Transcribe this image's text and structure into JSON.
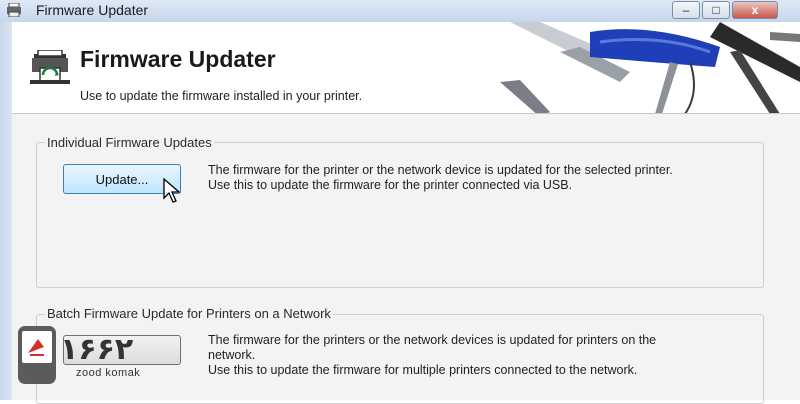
{
  "window": {
    "title": "Firmware Updater",
    "controls": {
      "minimize": "–",
      "maximize": "□",
      "close": "x"
    }
  },
  "header": {
    "title": "Firmware Updater",
    "subtitle": "Use to update the firmware installed in your printer."
  },
  "groups": [
    {
      "label": "Individual Firmware Updates",
      "button_label": "Update...",
      "description_lines": [
        "The firmware for the printer or the network device is updated for the selected printer.",
        "Use this to update the firmware for the printer connected via USB."
      ]
    },
    {
      "label": "Batch Firmware Update for Printers on a Network",
      "button_label": "",
      "description_lines": [
        "The firmware for the printers or the network devices is updated for printers on the",
        "network.",
        "Use this to update the firmware for multiple printers connected to the network."
      ]
    }
  ],
  "watermark": {
    "digits": "۱۶۶۲",
    "brand": "zood komak"
  },
  "icons": {
    "app": "printer-icon",
    "header": "printer-icon",
    "cursor": "mouse-pointer-icon"
  },
  "colors": {
    "titlebar": "#c6d6eb",
    "content_bg": "#f3f3f3",
    "button_hover": "#bee6fd",
    "art_blue": "#1f3fb8"
  }
}
